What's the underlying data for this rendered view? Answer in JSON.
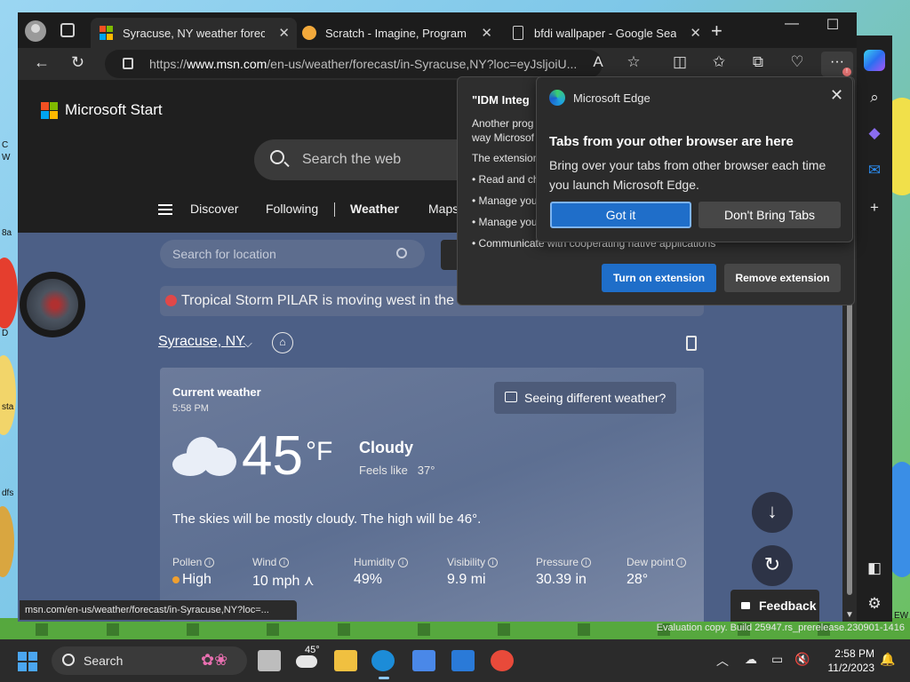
{
  "desktop": {
    "labels": [
      "C",
      "W",
      "8a",
      "D",
      "sta",
      "dfs",
      "EW"
    ],
    "watermark": "Evaluation copy. Build 25947.rs_prerelease.230901-1416"
  },
  "browser": {
    "tabs": [
      {
        "title": "Syracuse, NY weather forecast |",
        "active": true
      },
      {
        "title": "Scratch - Imagine, Program, Sh",
        "active": false
      },
      {
        "title": "bfdi wallpaper - Google Search",
        "active": false
      }
    ],
    "url_prefix": "https://",
    "url_domain": "www.msn.com",
    "url_rest": "/en-us/weather/forecast/in-Syracuse,NY?loc=eyJsljoiU...",
    "status_url": "msn.com/en-us/weather/forecast/in-Syracuse,NY?loc=..."
  },
  "msn": {
    "brand": "Microsoft Start",
    "search_placeholder": "Search the web",
    "nav": [
      "Discover",
      "Following",
      "Weather",
      "Maps"
    ],
    "location_placeholder": "Search for location",
    "alert": "Tropical Storm PILAR is moving west in the Ea",
    "location": "Syracuse, NY",
    "current": {
      "label": "Current weather",
      "time": "5:58 PM",
      "different_btn": "Seeing different weather?",
      "temp": "45",
      "unit": "°F",
      "condition": "Cloudy",
      "feels_like_label": "Feels like",
      "feels_like": "37°",
      "summary": "The skies will be mostly cloudy. The high will be 46°.",
      "metrics": [
        {
          "label": "Pollen",
          "value": "High"
        },
        {
          "label": "Wind",
          "value": "10 mph"
        },
        {
          "label": "Humidity",
          "value": "49%"
        },
        {
          "label": "Visibility",
          "value": "9.9 mi"
        },
        {
          "label": "Pressure",
          "value": "30.39 in"
        },
        {
          "label": "Dew point",
          "value": "28°"
        }
      ]
    },
    "feedback": "Feedback"
  },
  "idm_popup": {
    "title": "\"IDM Integ",
    "desc_line1": "Another prog",
    "desc_line2": "way Microsof",
    "desc_line3": "The extension",
    "perm1": "• Read and ch",
    "perm2": "• Manage you",
    "perm3": "• Manage you",
    "perm4": "• Communicate with cooperating native applications",
    "turn_on": "Turn on extension",
    "remove": "Remove extension"
  },
  "edge_popup": {
    "brand": "Microsoft Edge",
    "heading": "Tabs from your other browser are here",
    "body": "Bring over your tabs from other browser each time you launch Microsoft Edge.",
    "primary": "Got it",
    "secondary": "Don't Bring Tabs"
  },
  "taskbar": {
    "search_label": "Search",
    "weather_temp": "45°",
    "time": "2:58 PM",
    "date": "11/2/2023"
  },
  "colors": {
    "accent": "#1f6ec9",
    "page_bg": "#4c5f86",
    "pollen": "#f0a030"
  }
}
